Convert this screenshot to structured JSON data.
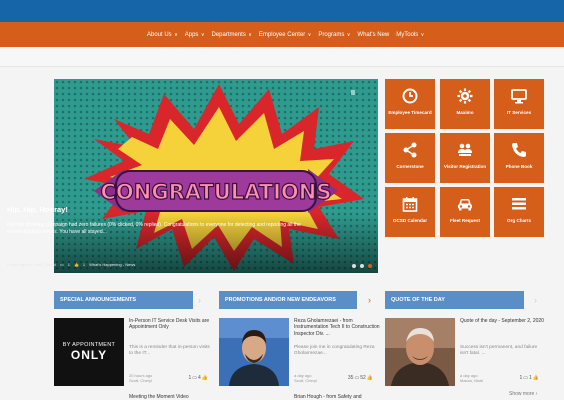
{
  "nav": {
    "items": [
      {
        "label": "About Us",
        "chevron": true
      },
      {
        "label": "Apps",
        "chevron": true
      },
      {
        "label": "Departments",
        "chevron": true
      },
      {
        "label": "Employee Center",
        "chevron": true
      },
      {
        "label": "Programs",
        "chevron": true
      },
      {
        "label": "What's New",
        "chevron": false
      },
      {
        "label": "MyTools",
        "chevron": true
      }
    ]
  },
  "hero": {
    "art_text": "CONGRATULATIONS",
    "title": "Hip, Hip, Hooray!",
    "text": "Our last phishing campaign had zero failures (0% clicked, 0% replied). Congratulations to everyone for detecting and reporting all the recent phishing emails. You have all stayed...",
    "meta": "8 days ago by Scott, Cheryl",
    "comments": "1",
    "likes": "1",
    "category": "What's Happening - News",
    "pause_icon": "pause-icon"
  },
  "tiles": [
    {
      "label": "Employee Timecard",
      "icon": "clock-icon"
    },
    {
      "label": "Maximo",
      "icon": "gear-icon"
    },
    {
      "label": "IT Services",
      "icon": "monitor-icon"
    },
    {
      "label": "Cornerstone",
      "icon": "share-icon"
    },
    {
      "label": "Visitor Registration",
      "icon": "people-icon"
    },
    {
      "label": "Phone Book",
      "icon": "phone-icon"
    },
    {
      "label": "OCSD Calendar",
      "icon": "calendar-icon"
    },
    {
      "label": "Fleet Request",
      "icon": "car-icon"
    },
    {
      "label": "Org Charts",
      "icon": "list-icon"
    }
  ],
  "sections": {
    "special": "SPECIAL ANNOUNCEMENTS",
    "promotions": "PROMOTIONS AND/OR NEW ENDEAVORS",
    "quote": "QUOTE OF THE DAY"
  },
  "cards": [
    {
      "img_top": "BY APPOINTMENT",
      "img_big": "ONLY",
      "title": "In-Person IT Service Desk Visits are Appointment Only",
      "excerpt": "This is a reminder that in-person visits to the IT...",
      "time": "20 hours ago",
      "author": "Scott, Cheryl",
      "comments": "1",
      "likes": "4"
    },
    {
      "title": "Reza Gholamrezaei - from Instrumentation Tech II to Construction Inspector Div. ...",
      "excerpt": "Please join me in congratulating Reza Gholamrezae...",
      "time": "a day ago",
      "author": "Scott, Cheryl",
      "comments": "35",
      "likes": "52"
    },
    {
      "title": "Quote of the day - September 2, 2020",
      "excerpt": "Success isn't permanent, and failure isn't fatal. ...",
      "time": "a day ago",
      "author": "Macau, Mark",
      "comments": "1",
      "likes": "1"
    }
  ],
  "show_more": "Show more",
  "bottom": {
    "left": "Meeting the Moment Video",
    "mid": "Brian Hough - from Safety and"
  },
  "colors": {
    "brand_orange": "#d55e1a",
    "brand_blue": "#1565a8",
    "section_blue": "#5a8ec6"
  }
}
